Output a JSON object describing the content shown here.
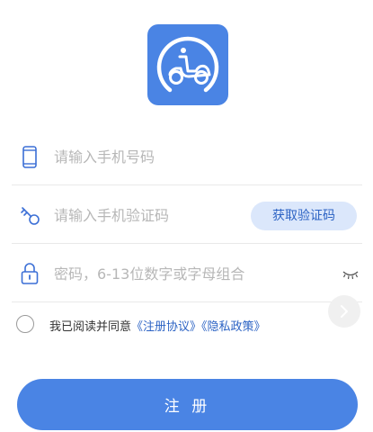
{
  "app": {
    "logo_icon": "scooter-icon",
    "accent_color": "#4a84e4"
  },
  "form": {
    "phone": {
      "icon": "phone-icon",
      "placeholder": "请输入手机号码",
      "value": ""
    },
    "code": {
      "icon": "key-icon",
      "placeholder": "请输入手机验证码",
      "value": "",
      "send_button_label": "获取验证码"
    },
    "password": {
      "icon": "lock-icon",
      "placeholder": "密码，6-13位数字或字母组合",
      "value": "",
      "toggle_icon": "eye-closed-icon"
    }
  },
  "next_icon": "chevron-right-icon",
  "agreement": {
    "checked": false,
    "prefix": "我已阅读并同意",
    "terms_link": "《注册协议》",
    "privacy_link": "《隐私政策》"
  },
  "submit": {
    "label": "注 册"
  }
}
